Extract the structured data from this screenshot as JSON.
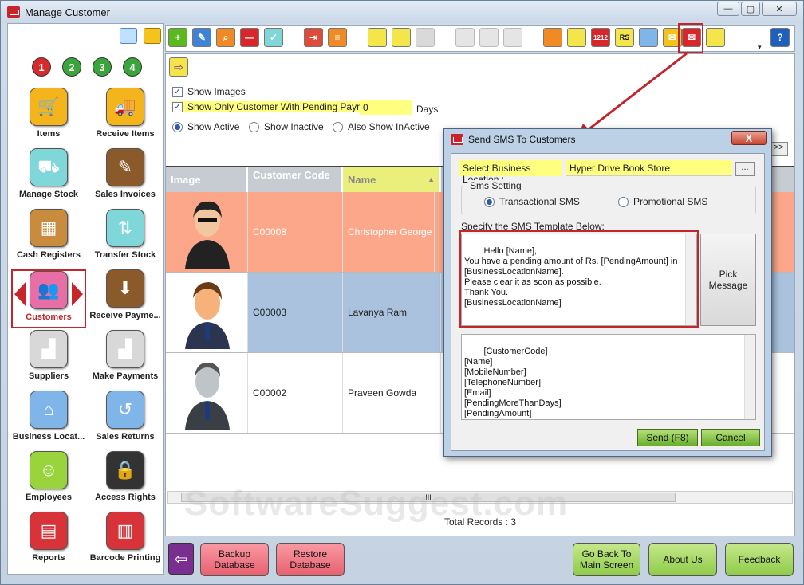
{
  "window": {
    "title": "Manage Customer"
  },
  "sidebar": {
    "steps": [
      "1",
      "2",
      "3",
      "4"
    ],
    "items": [
      {
        "label": "Items",
        "icon": "cart-icon",
        "color": "#f4b41c"
      },
      {
        "label": "Receive Items",
        "icon": "truck-icon",
        "color": "#f4b41c"
      },
      {
        "label": "Manage Stock",
        "icon": "hand-truck-icon",
        "color": "#7fd7d9"
      },
      {
        "label": "Sales Invoices",
        "icon": "invoice-icon",
        "color": "#8a5a2b"
      },
      {
        "label": "Cash Registers",
        "icon": "cash-register-icon",
        "color": "#c98b3d"
      },
      {
        "label": "Transfer Stock",
        "icon": "transfer-icon",
        "color": "#7fd7d9"
      },
      {
        "label": "Customers",
        "icon": "customers-icon",
        "color": "#e86ea6"
      },
      {
        "label": "Receive Payme...",
        "icon": "receive-payment-icon",
        "color": "#8a5a2b"
      },
      {
        "label": "Suppliers",
        "icon": "factory-icon",
        "color": "#d8d8d8"
      },
      {
        "label": "Make Payments",
        "icon": "factory-pay-icon",
        "color": "#d8d8d8"
      },
      {
        "label": "Business Locat...",
        "icon": "store-icon",
        "color": "#7fb5e8"
      },
      {
        "label": "Sales Returns",
        "icon": "return-cart-icon",
        "color": "#7fb5e8"
      },
      {
        "label": "Employees",
        "icon": "employee-icon",
        "color": "#9ad43c"
      },
      {
        "label": "Access Rights",
        "icon": "lock-icon",
        "color": "#333333"
      },
      {
        "label": "Reports",
        "icon": "report-scroll-icon",
        "color": "#d9333a"
      },
      {
        "label": "Barcode Printing",
        "icon": "barcode-icon",
        "color": "#d9333a"
      }
    ]
  },
  "filters": {
    "show_images": "Show Images",
    "pending_only": "Show Only Customer With Pending Payment",
    "pending_days_value": "0",
    "days_label": "Days",
    "show_active": "Show Active",
    "show_inactive": "Show Inactive",
    "also_inactive": "Also Show InActive"
  },
  "grid": {
    "headers": [
      "Image",
      "Customer Code",
      "Name"
    ],
    "rows": [
      {
        "code": "C00008",
        "name": "Christopher George"
      },
      {
        "code": "C00003",
        "name": "Lavanya Ram"
      },
      {
        "code": "C00002",
        "name": "Praveen Gowda"
      }
    ],
    "total_records": "Total Records : 3",
    "scroll_grip": "III"
  },
  "footer": {
    "backup": "Backup Database",
    "restore": "Restore Database",
    "go_back": "Go Back To Main Screen",
    "about": "About Us",
    "feedback": "Feedback"
  },
  "dialog": {
    "title": "Send SMS To Customers",
    "location_label": "Select Business Location :",
    "location_value": "Hyper Drive Book Store",
    "browse": "...",
    "sms_setting": "Sms Setting",
    "transactional": "Transactional SMS",
    "promotional": "Promotional SMS",
    "template_label": "Specify the SMS Template Below:",
    "template_text": "Hello [Name],\nYou have a pending amount of Rs. [PendingAmount] in\n[BusinessLocationName].\nPlease clear it as soon as possible.\nThank You.\n[BusinessLocationName]",
    "pick_message": "Pick Message",
    "placeholders": "[CustomerCode]\n[Name]\n[MobileNumber]\n[TelephoneNumber]\n[Email]\n[PendingMoreThanDays]\n[PendingAmount]\n[BusinessLocationName]",
    "send": "Send (F8)",
    "cancel": "Cancel",
    "close": "X"
  },
  "toolbar_rs": "RS",
  "watermark": "SoftwareSuggest.com"
}
